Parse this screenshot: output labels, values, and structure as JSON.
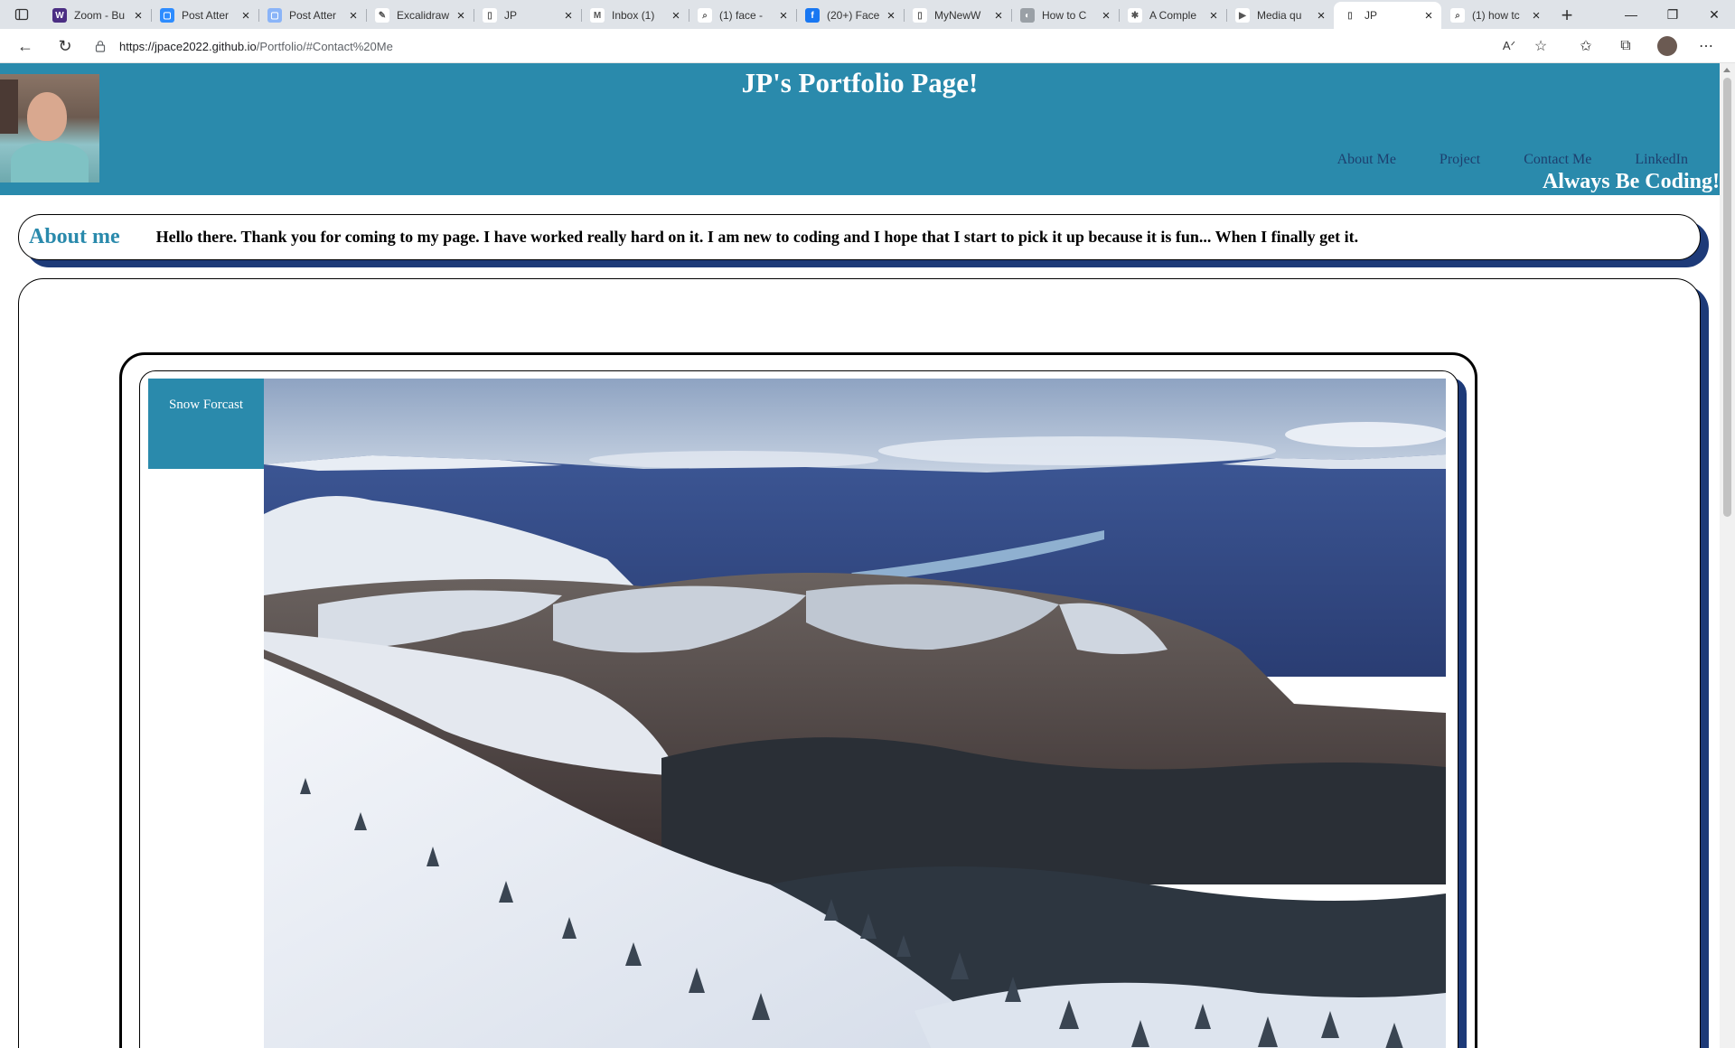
{
  "browser": {
    "tabs": [
      {
        "title": "Zoom - Bu",
        "icon": "university-w-icon",
        "color": "#4b2e83",
        "glyph": "W"
      },
      {
        "title": "Post Atter",
        "icon": "zoom-icon",
        "color": "#2d8cff",
        "glyph": "▢"
      },
      {
        "title": "Post Atter",
        "icon": "zoom-icon",
        "color": "#8ab4f8",
        "glyph": "▢"
      },
      {
        "title": "Excalidraw",
        "icon": "excalidraw-icon",
        "color": "#ffffff",
        "glyph": "✎"
      },
      {
        "title": "JP",
        "icon": "page-icon",
        "color": "#ffffff",
        "glyph": "▯"
      },
      {
        "title": "Inbox (1)",
        "icon": "gmail-icon",
        "color": "#ffffff",
        "glyph": "M"
      },
      {
        "title": "(1) face -",
        "icon": "search-icon",
        "color": "#ffffff",
        "glyph": "⌕"
      },
      {
        "title": "(20+) Face",
        "icon": "facebook-icon",
        "color": "#1877f2",
        "glyph": "f"
      },
      {
        "title": "MyNewW",
        "icon": "page-icon",
        "color": "#ffffff",
        "glyph": "▯"
      },
      {
        "title": "How to C",
        "icon": "globe-icon",
        "color": "#9aa0a6",
        "glyph": "◐"
      },
      {
        "title": "A Comple",
        "icon": "asterisk-icon",
        "color": "#ffffff",
        "glyph": "✱"
      },
      {
        "title": "Media qu",
        "icon": "media-icon",
        "color": "#ffffff",
        "glyph": "▶"
      },
      {
        "title": "JP",
        "icon": "page-icon",
        "color": "#ffffff",
        "glyph": "▯",
        "active": true
      },
      {
        "title": "(1) how tc",
        "icon": "search-icon",
        "color": "#ffffff",
        "glyph": "⌕"
      }
    ],
    "url_host": "https://jpace2022.github.io",
    "url_path": "/Portfolio/#Contact%20Me"
  },
  "site": {
    "title": "JP's Portfolio Page!",
    "tagline": "Always Be Coding!",
    "nav": [
      "About Me",
      "Project",
      "Contact Me",
      "LinkedIn"
    ],
    "brand_color": "#2a8aac",
    "shadow_color": "#1d3a78"
  },
  "about": {
    "heading": "About me",
    "text": "Hello there. Thank you for coming to my page. I have worked really hard on it. I am new to coding and I hope that I start to pick it up because it is fun... When I finally get it."
  },
  "project": {
    "label": "Snow Forcast"
  }
}
